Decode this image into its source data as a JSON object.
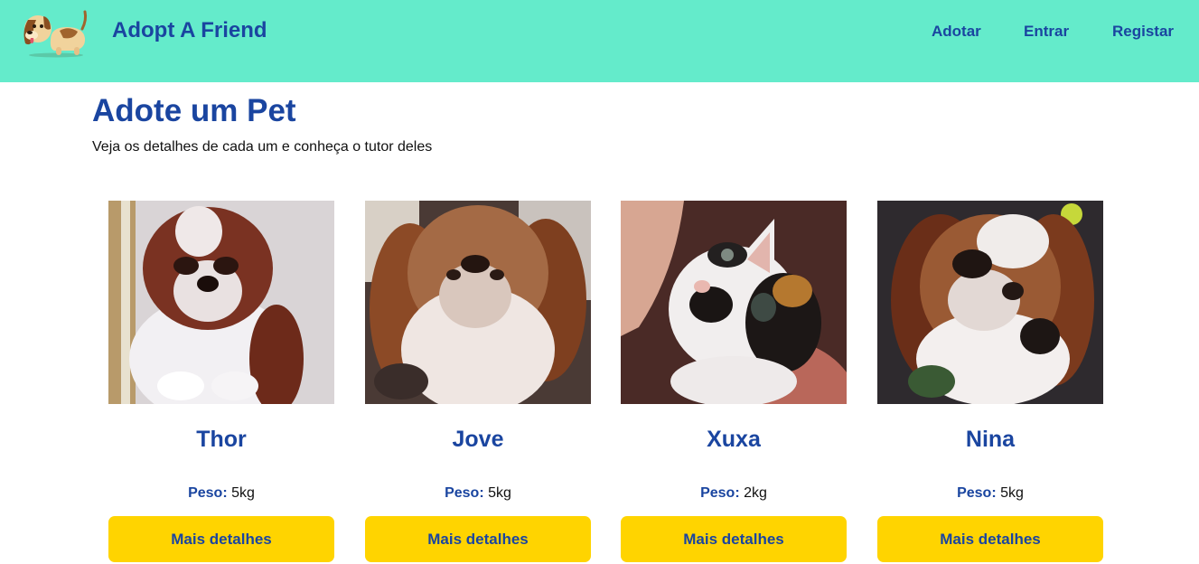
{
  "header": {
    "brand": "Adopt A Friend",
    "logo_icon": "dog-logo-icon",
    "nav": [
      {
        "label": "Adotar"
      },
      {
        "label": "Entrar"
      },
      {
        "label": "Registar"
      }
    ]
  },
  "main": {
    "title": "Adote um Pet",
    "subtitle": "Veja os detalhes de cada um e conheça o tutor deles",
    "weight_label": "Peso:",
    "button_label": "Mais detalhes",
    "pets": [
      {
        "name": "Thor",
        "weight": "5kg",
        "photo": "shih-tzu-brown-white-photo"
      },
      {
        "name": "Jove",
        "weight": "5kg",
        "photo": "shih-tzu-brown-white-photo"
      },
      {
        "name": "Xuxa",
        "weight": "2kg",
        "photo": "calico-kitten-photo"
      },
      {
        "name": "Nina",
        "weight": "5kg",
        "photo": "shih-tzu-tricolor-photo"
      }
    ]
  },
  "colors": {
    "navbar": "#64ebcb",
    "primary_text": "#1a45a0",
    "button": "#ffd400"
  }
}
